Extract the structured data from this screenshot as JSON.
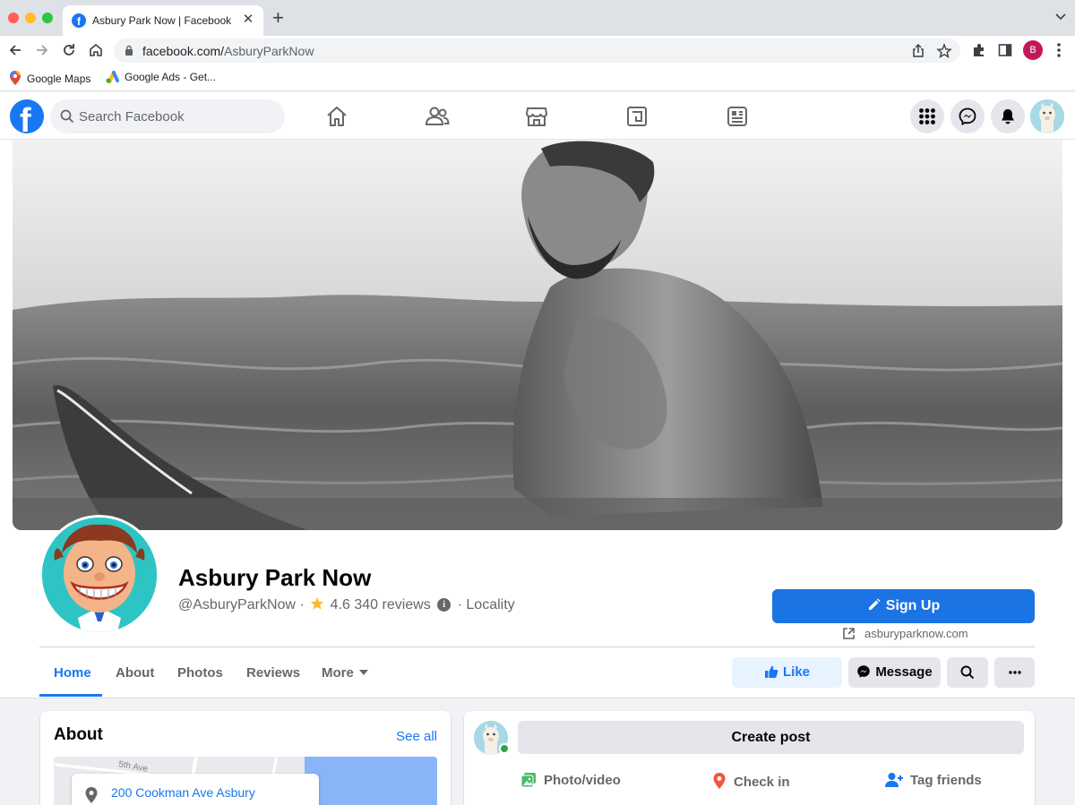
{
  "browser": {
    "tab_title": "Asbury Park Now | Facebook",
    "url_host": "facebook.com/",
    "url_path": "AsburyParkNow",
    "profile_initial": "B",
    "bookmarks": [
      {
        "label": "Google Maps"
      },
      {
        "label": "Google Ads - Get..."
      }
    ]
  },
  "fb_header": {
    "logo_letter": "f",
    "search_placeholder": "Search Facebook"
  },
  "page": {
    "name": "Asbury Park Now",
    "handle": "@AsburyParkNow",
    "separator": "·",
    "rating": "4.6",
    "reviews": "340 reviews",
    "category": "Locality",
    "signup_label": "Sign Up",
    "website": "asburyparknow.com"
  },
  "profile_tabs": {
    "home": "Home",
    "about": "About",
    "photos": "Photos",
    "reviews": "Reviews",
    "more": "More"
  },
  "actions": {
    "like": "Like",
    "message": "Message"
  },
  "about_card": {
    "title": "About",
    "see_all": "See all",
    "address": "200 Cookman Ave Asbury",
    "map_street": "5th Ave"
  },
  "post_card": {
    "create_post": "Create post",
    "photo_video": "Photo/video",
    "check_in": "Check in",
    "tag_friends": "Tag friends"
  },
  "colors": {
    "facebook_blue": "#1877f2",
    "signup_blue": "#1b74e4",
    "profile_teal": "#2ec4c4"
  }
}
